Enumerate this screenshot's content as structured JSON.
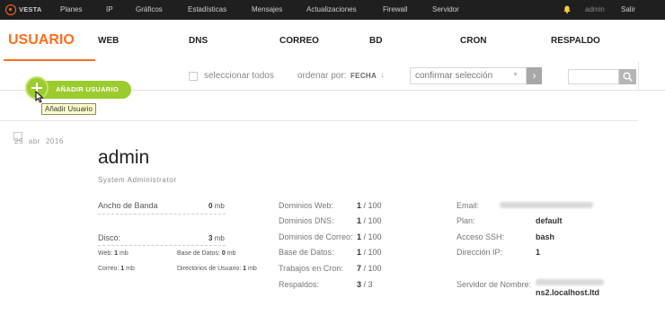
{
  "topbar": {
    "logo_text": "VESTA",
    "nav": [
      "Planes",
      "IP",
      "Gráficos",
      "Estadísticas",
      "Mensajes",
      "Actualizaciones",
      "Firewall",
      "Servidor"
    ],
    "bell_icon": "bell-icon",
    "user": "admin",
    "logout": "Salir"
  },
  "tabs": [
    "USUARIO",
    "WEB",
    "DNS",
    "CORREO",
    "BD",
    "CRON",
    "RESPALDO"
  ],
  "toolbar": {
    "select_all": "seleccionar todos",
    "sort_label": "ordenar por:",
    "sort_value": "FECHA",
    "sort_arrow": "↓",
    "confirm_placeholder": "confirmar selección",
    "confirm_arrow": "›",
    "search_placeholder": ""
  },
  "add_user": {
    "label": "AÑADIR USUARIO",
    "tooltip": "Añadir Usuario"
  },
  "user_row": {
    "date_day": "25",
    "date_month": "abr",
    "date_year": "2016",
    "name": "admin",
    "role": "System Administrator",
    "bandwidth_label": "Ancho de Banda",
    "bandwidth_value": "0",
    "bandwidth_unit": "mb",
    "disk_label": "Disco:",
    "disk_value": "3",
    "disk_unit": "mb",
    "web_label": "Web:",
    "web_value": "1",
    "web_unit": "mb",
    "db_label": "Base de Datos:",
    "db_value": "0",
    "db_unit": "mb",
    "mail_label": "Correo:",
    "mail_value": "1",
    "mail_unit": "mb",
    "dirs_label": "Directorios de Usuario:",
    "dirs_value": "1",
    "dirs_unit": "mb",
    "stats": [
      {
        "label": "Dominios Web:",
        "used": "1",
        "limit": "/ 100"
      },
      {
        "label": "Dominios DNS:",
        "used": "1",
        "limit": "/ 100"
      },
      {
        "label": "Dominios de Correo:",
        "used": "1",
        "limit": "/ 100"
      },
      {
        "label": "Base de Datos:",
        "used": "1",
        "limit": "/ 100"
      },
      {
        "label": "Trabajos en Cron:",
        "used": "7",
        "limit": "/ 100"
      },
      {
        "label": "Respaldos:",
        "used": "3",
        "limit": "/ 3"
      }
    ],
    "details": [
      {
        "label": "Email:",
        "value": ""
      },
      {
        "label": "Plan:",
        "value": "default"
      },
      {
        "label": "Acceso SSH:",
        "value": "bash"
      },
      {
        "label": "Dirección IP:",
        "value": "1"
      }
    ],
    "nameserver_label": "Servidor de Nombre:",
    "nameserver_value": "ns2.localhost.ltd"
  }
}
